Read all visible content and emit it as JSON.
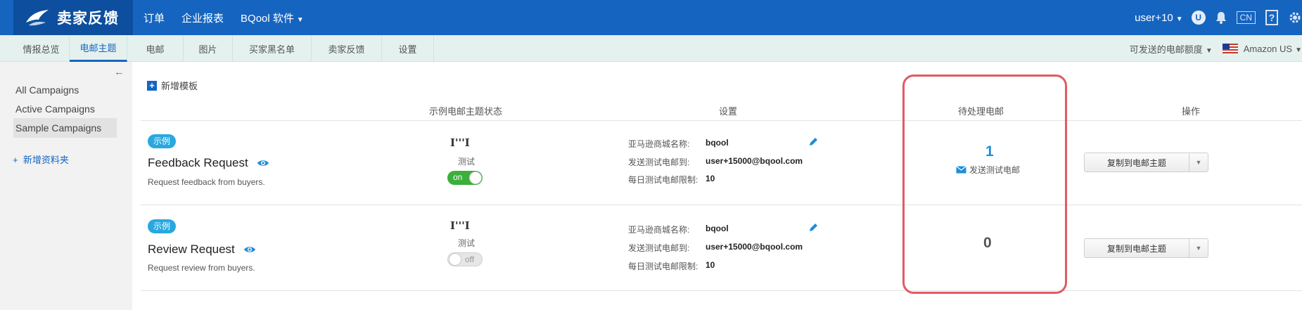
{
  "topbar": {
    "logo_text": "卖家反馈",
    "nav": [
      "订单",
      "企业报表",
      "BQool 软件"
    ],
    "user": "user+10",
    "user_badge": "U",
    "lang": "CN",
    "help": "?"
  },
  "subnav": {
    "tabs": [
      "情报总览",
      "电邮主题",
      "电邮",
      "图片",
      "买家黑名单",
      "卖家反馈",
      "设置"
    ],
    "active_tab": "电邮主题",
    "quota": "可发送的电邮额度",
    "marketplace": "Amazon US"
  },
  "sidebar": {
    "items": [
      "All Campaigns",
      "Active Campaigns",
      "Sample Campaigns"
    ],
    "selected": "Sample Campaigns",
    "add_folder": "新增资料夹"
  },
  "main": {
    "new_template": "新增模板",
    "headers": {
      "status": "示例电邮主题状态",
      "settings": "设置",
      "pending": "待处理电邮",
      "actions": "操作"
    },
    "rows": [
      {
        "badge": "示例",
        "title": "Feedback Request",
        "description": "Request feedback from buyers.",
        "test_icon": "I'''I",
        "test_label": "测试",
        "toggle": "on",
        "settings": [
          {
            "label": "亚马逊商城名称:",
            "value": "bqool"
          },
          {
            "label": "发送测试电邮到:",
            "value": "user+15000@bqool.com"
          },
          {
            "label": "每日测试电邮限制:",
            "value": "10"
          }
        ],
        "pending": "1",
        "pending_link": "发送测试电邮",
        "action": "复制到电邮主题"
      },
      {
        "badge": "示例",
        "title": "Review Request",
        "description": "Request review from buyers.",
        "test_icon": "I'''I",
        "test_label": "测试",
        "toggle": "off",
        "settings": [
          {
            "label": "亚马逊商城名称:",
            "value": "bqool"
          },
          {
            "label": "发送测试电邮到:",
            "value": "user+15000@bqool.com"
          },
          {
            "label": "每日测试电邮限制:",
            "value": "10"
          }
        ],
        "pending": "0",
        "action": "复制到电邮主题"
      }
    ]
  },
  "colors": {
    "primary": "#1565c0",
    "toggle_on": "#3cae3c",
    "badge": "#29a8e0",
    "highlight": "#e05b63"
  },
  "icons": [
    "logo-bird-icon",
    "bell-icon",
    "gear-icon",
    "help-icon",
    "eye-icon",
    "pencil-icon",
    "mail-icon",
    "us-flag-icon",
    "plus-icon",
    "arrow-left-icon"
  ]
}
